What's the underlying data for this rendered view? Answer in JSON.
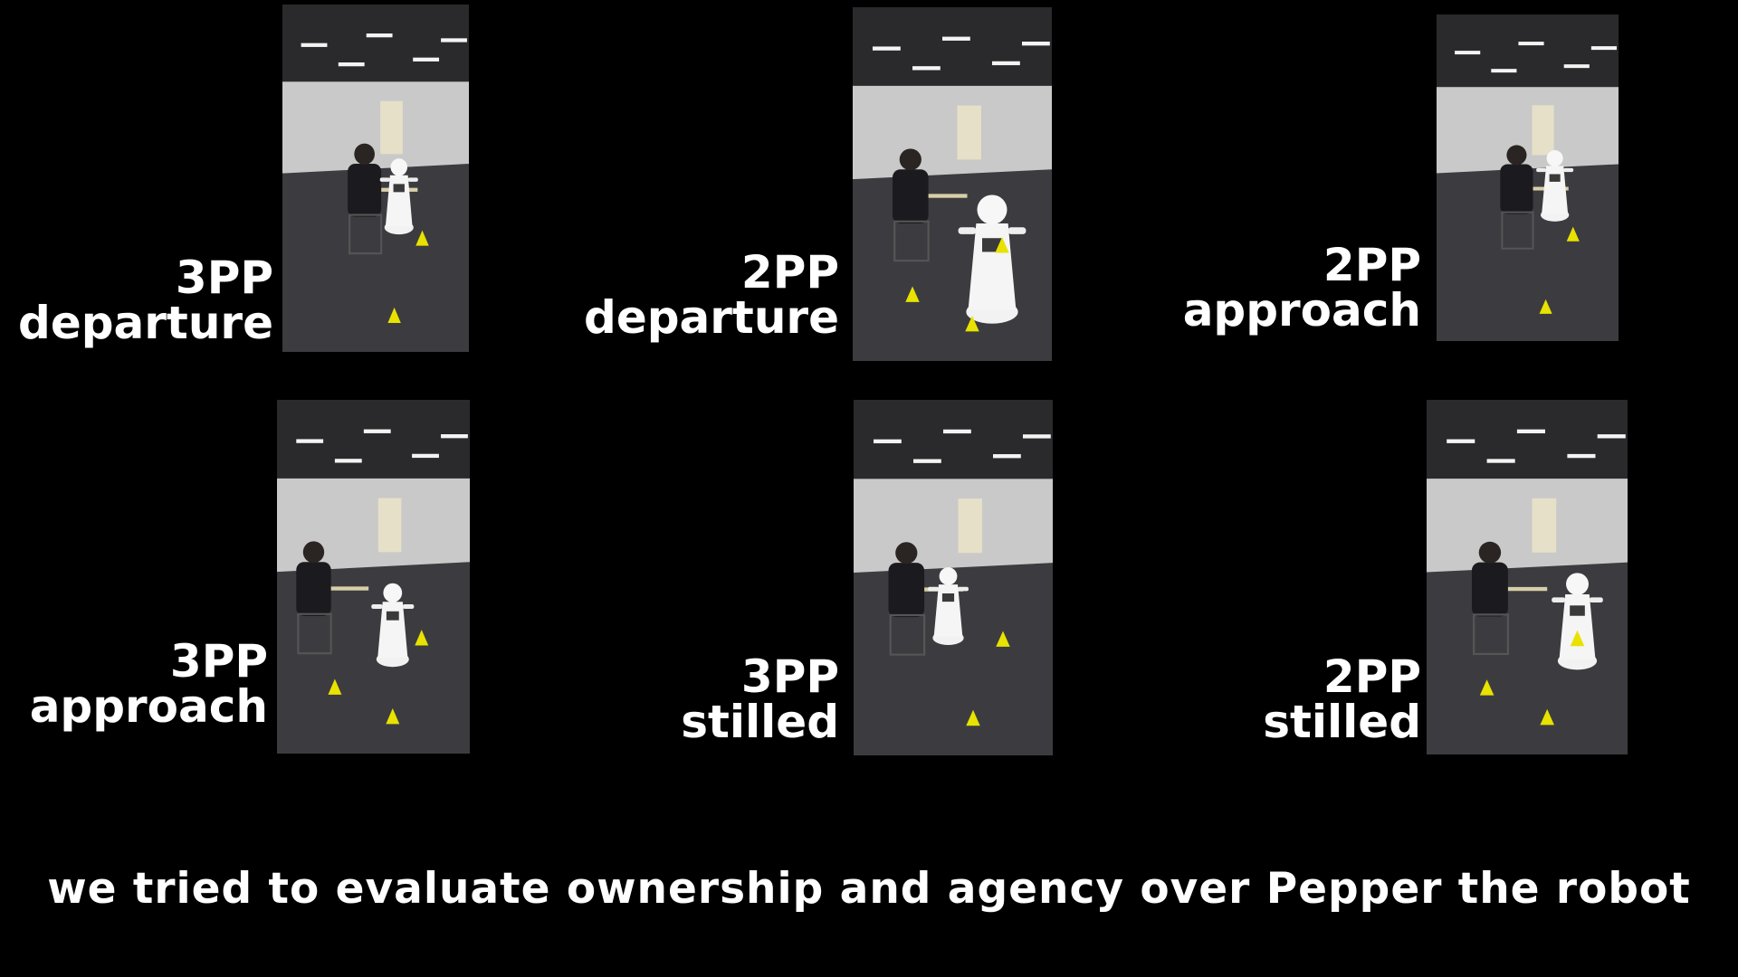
{
  "panels": [
    {
      "id": "p1",
      "line1": "3PP",
      "line2": "departure",
      "view": "third-person"
    },
    {
      "id": "p2",
      "line1": "2PP",
      "line2": "departure",
      "view": "second-person"
    },
    {
      "id": "p3",
      "line1": "2PP",
      "line2": "approach",
      "view": "third-person"
    },
    {
      "id": "p4",
      "line1": "3PP",
      "line2": "approach",
      "view": "third-person"
    },
    {
      "id": "p5",
      "line1": "3PP",
      "line2": "stilled",
      "view": "second-person"
    },
    {
      "id": "p6",
      "line1": "2PP",
      "line2": "stilled",
      "view": "second-person"
    }
  ],
  "caption": "we tried to evaluate ownership and agency over Pepper the robot",
  "colors": {
    "background": "#000000",
    "text": "#ffffff",
    "cone": "#e8e200",
    "floor": "#3c3c40",
    "ceiling": "#2a2a2c",
    "wall": "#c9c9c9"
  }
}
